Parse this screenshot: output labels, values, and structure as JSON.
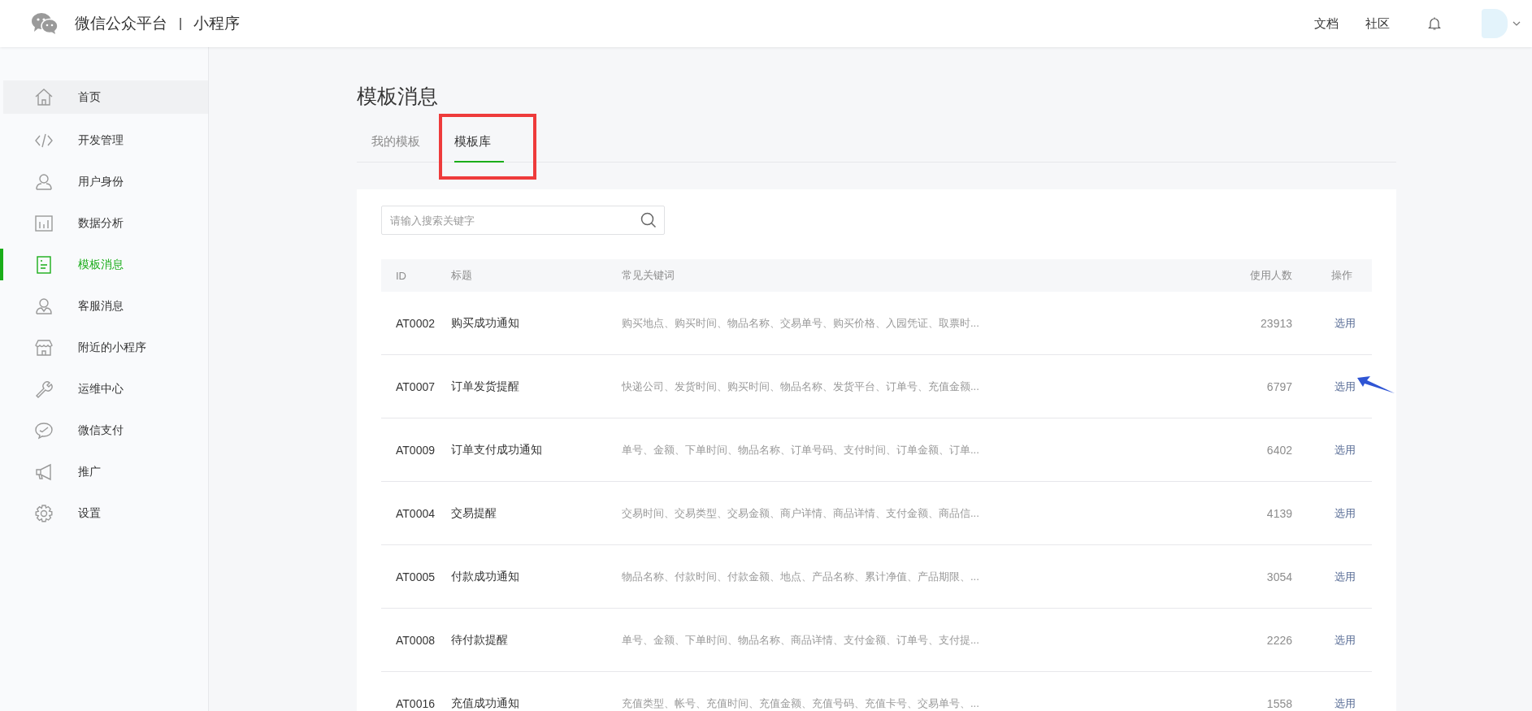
{
  "header": {
    "brand": "微信公众平台",
    "separator": "|",
    "product": "小程序",
    "links": [
      "文档",
      "社区"
    ]
  },
  "sidebar": {
    "items": [
      {
        "label": "首页",
        "selected": false,
        "hovered": true
      },
      {
        "label": "开发管理",
        "selected": false,
        "hovered": false
      },
      {
        "label": "用户身份",
        "selected": false,
        "hovered": false
      },
      {
        "label": "数据分析",
        "selected": false,
        "hovered": false
      },
      {
        "label": "模板消息",
        "selected": true,
        "hovered": false
      },
      {
        "label": "客服消息",
        "selected": false,
        "hovered": false
      },
      {
        "label": "附近的小程序",
        "selected": false,
        "hovered": false
      },
      {
        "label": "运维中心",
        "selected": false,
        "hovered": false
      },
      {
        "label": "微信支付",
        "selected": false,
        "hovered": false
      },
      {
        "label": "推广",
        "selected": false,
        "hovered": false
      },
      {
        "label": "设置",
        "selected": false,
        "hovered": false
      }
    ]
  },
  "page_title": "模板消息",
  "tabs": [
    {
      "label": "我的模板",
      "selected": false,
      "framed": false
    },
    {
      "label": "模板库",
      "selected": true,
      "framed": true
    }
  ],
  "search": {
    "placeholder": "请输入搜索关键字"
  },
  "table": {
    "columns": [
      "ID",
      "标题",
      "常见关键词",
      "使用人数",
      "操作"
    ],
    "rows": [
      {
        "id": "AT0002",
        "title": "购买成功通知",
        "keywords": "购买地点、购买时间、物品名称、交易单号、购买价格、入园凭证、取票时...",
        "users": "23913",
        "action": "选用",
        "annotated": false
      },
      {
        "id": "AT0007",
        "title": "订单发货提醒",
        "keywords": "快递公司、发货时间、购买时间、物品名称、发货平台、订单号、充值金额...",
        "users": "6797",
        "action": "选用",
        "annotated": true
      },
      {
        "id": "AT0009",
        "title": "订单支付成功通知",
        "keywords": "单号、金额、下单时间、物品名称、订单号码、支付时间、订单金额、订单...",
        "users": "6402",
        "action": "选用",
        "annotated": false
      },
      {
        "id": "AT0004",
        "title": "交易提醒",
        "keywords": "交易时间、交易类型、交易金额、商户详情、商品详情、支付金额、商品信...",
        "users": "4139",
        "action": "选用",
        "annotated": false
      },
      {
        "id": "AT0005",
        "title": "付款成功通知",
        "keywords": "物品名称、付款时间、付款金额、地点、产品名称、累计净值、产品期限、...",
        "users": "3054",
        "action": "选用",
        "annotated": false
      },
      {
        "id": "AT0008",
        "title": "待付款提醒",
        "keywords": "单号、金额、下单时间、物品名称、商品详情、支付金额、订单号、支付提...",
        "users": "2226",
        "action": "选用",
        "annotated": false
      },
      {
        "id": "AT0016",
        "title": "充值成功通知",
        "keywords": "充值类型、帐号、充值时间、充值金额、充值号码、充值卡号、交易单号、...",
        "users": "1558",
        "action": "选用",
        "annotated": false
      }
    ]
  }
}
